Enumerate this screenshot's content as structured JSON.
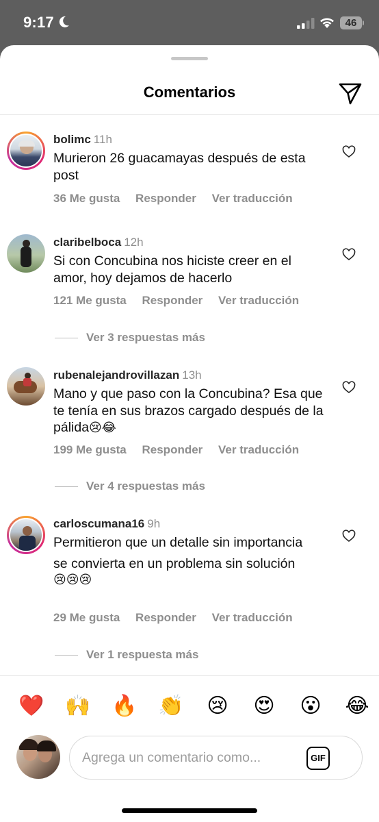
{
  "status_bar": {
    "time": "9:17",
    "battery": "46"
  },
  "sheet": {
    "title": "Comentarios"
  },
  "comments": [
    {
      "username": "bolimc",
      "time": "11h",
      "text": "Murieron 26 guacamayas después de esta post",
      "likes": "36 Me gusta",
      "reply": "Responder",
      "translate": "Ver traducción"
    },
    {
      "username": "claribelboca",
      "time": "12h",
      "text": "Si con Concubina nos hiciste creer en el amor, hoy dejamos de hacerlo",
      "likes": "121 Me gusta",
      "reply": "Responder",
      "translate": "Ver traducción",
      "replies": "Ver 3 respuestas más"
    },
    {
      "username": "rubenalejandrovillazan",
      "time": "13h",
      "text": "Mano y que paso con la Concubina? Esa que te tenía en sus brazos cargado después de la pálida",
      "text_emoji": "😢😂",
      "likes": "199 Me gusta",
      "reply": "Responder",
      "translate": "Ver traducción",
      "replies": "Ver 4 respuestas más"
    },
    {
      "username": "carloscumana16",
      "time": "9h",
      "text": "Permitieron que un detalle sin importancia",
      "text_line2": "se convierta en un problema sin solución",
      "text_emoji": "😢😢😢",
      "likes": "29 Me gusta",
      "reply": "Responder",
      "translate": "Ver traducción",
      "replies": "Ver 1 respuesta más"
    }
  ],
  "emoji_bar": [
    "❤️",
    "🙌",
    "🔥",
    "👏",
    "😢",
    "😍",
    "😮",
    "😂"
  ],
  "composer": {
    "placeholder": "Agrega un comentario como...",
    "gif_label": "GIF"
  },
  "icons": {
    "share": "paper-plane-icon",
    "like": "heart-outline-icon",
    "dnd": "moon-icon"
  }
}
